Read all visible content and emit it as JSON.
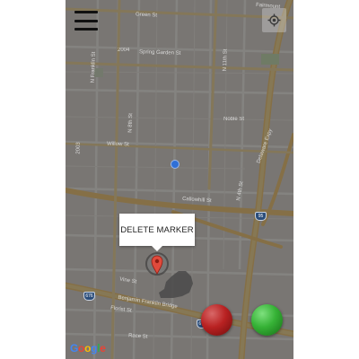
{
  "app": {
    "menu_icon": "hamburger-menu-icon",
    "locate_icon": "crosshair-locate-icon"
  },
  "map": {
    "streets": {
      "fairmount": "Fairmount",
      "green_st": "Green St",
      "spring_garden_st": "Spring Garden St",
      "n_franklin_st": "N Franklin St",
      "n_11th_st": "N 11th St",
      "n_8th_st": "N 8th St",
      "noble_st": "Noble St",
      "willow_st": "Willow St",
      "callowhill_st": "Callowhill St",
      "n_4th_st": "N 4th St",
      "delaware_expy": "Delaware Expy",
      "vine_st": "Vine St",
      "ben_franklin_bridge": "Benjamin Franklin Bridge",
      "florist_st": "Florist St",
      "race_st": "Race St"
    },
    "route_labels": {
      "r2004": "2004",
      "r2003": "2003"
    },
    "shields": {
      "i95": "95",
      "i676": "676",
      "i676b": "676"
    }
  },
  "marker_popup": {
    "label": "DELETE MARKER"
  },
  "buttons": {
    "red_color": "#b92222",
    "green_color": "#36b236"
  },
  "branding": {
    "google": [
      "G",
      "o",
      "o",
      "g",
      "l",
      "e"
    ],
    "google_colors": [
      "#4285F4",
      "#EA4335",
      "#FBBC05",
      "#4285F4",
      "#34A853",
      "#EA4335"
    ]
  }
}
